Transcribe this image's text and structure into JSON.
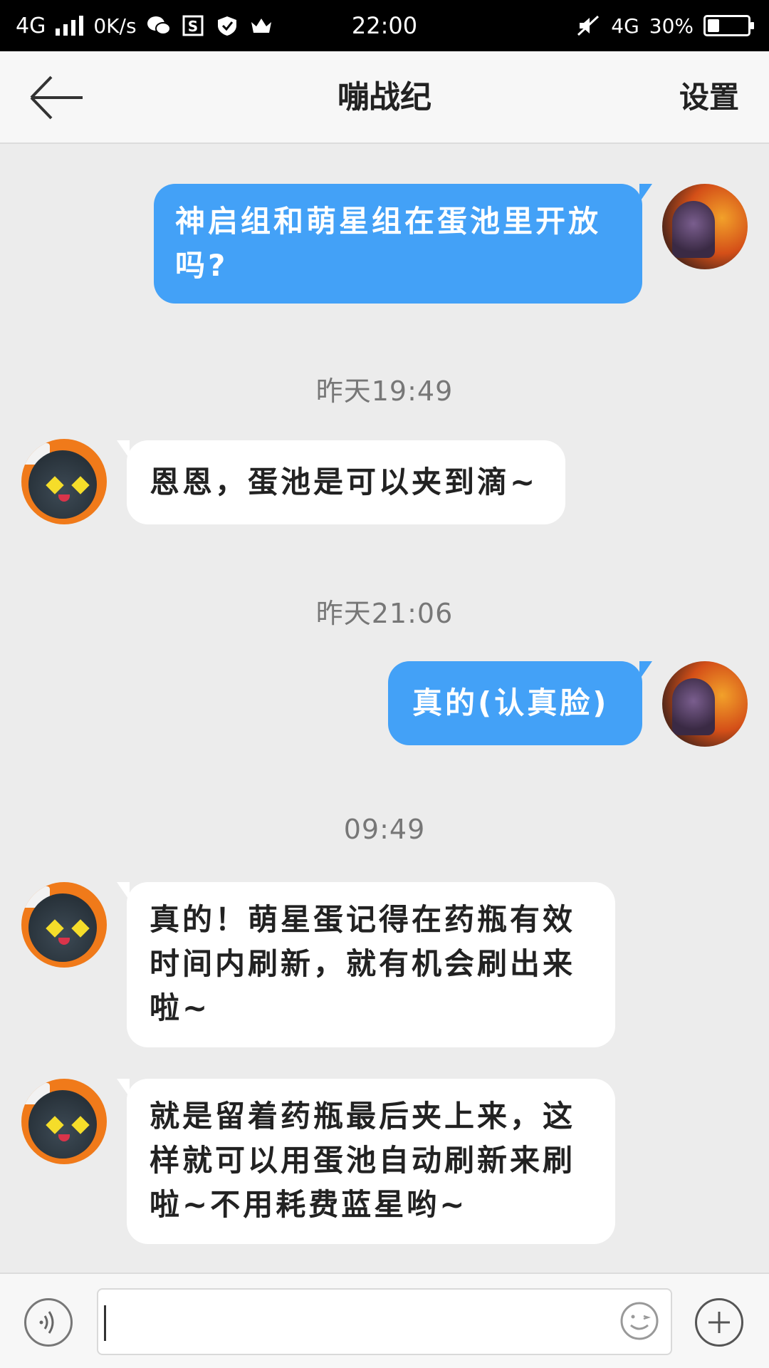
{
  "status_bar": {
    "network_left": "4G",
    "speed": "0K/s",
    "time": "22:00",
    "network_right": "4G",
    "battery_percent_text": "30%",
    "battery_level": 0.3
  },
  "header": {
    "title": "嘣战纪",
    "settings_label": "设置"
  },
  "messages": [
    {
      "text": "神启组和萌星组在蛋池里开放\n吗?"
    },
    {
      "text": "恩恩，蛋池是可以夹到滴~"
    },
    {
      "text": "真的(认真脸)"
    },
    {
      "text": "真的！萌星蛋记得在药瓶有效\n时间内刷新，就有机会刷出来\n啦~"
    },
    {
      "text": "就是留着药瓶最后夹上来，这\n样就可以用蛋池自动刷新来刷\n啦~不用耗费蓝星哟~"
    }
  ],
  "timestamps": [
    "昨天19:49",
    "昨天21:06",
    "09:49"
  ],
  "input": {
    "value": "",
    "placeholder": ""
  },
  "colors": {
    "outgoing_bubble": "#43a1f7",
    "incoming_bubble": "#ffffff",
    "background": "#ececec"
  },
  "icons": {
    "back": "back-arrow-icon",
    "voice": "voice-icon",
    "emoji": "emoji-icon",
    "plus": "plus-icon"
  }
}
